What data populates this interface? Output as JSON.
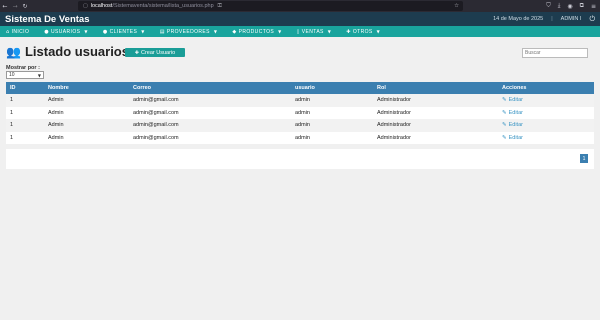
{
  "browser": {
    "host": "localhost",
    "path": "/Sistemaventa/sistema/lista_usuarios.php"
  },
  "header": {
    "app_title": "Sistema De Ventas",
    "date": "14 de Mayo de 2025",
    "separator": "|",
    "user": "ADMIN ",
    "user_badge": "I"
  },
  "nav": {
    "items": [
      {
        "label": "INICIO",
        "icon": "home-icon"
      },
      {
        "label": "USUARIOS",
        "icon": "user-icon"
      },
      {
        "label": "CLIENTES",
        "icon": "users-icon"
      },
      {
        "label": "PROVEEDORES",
        "icon": "building-icon"
      },
      {
        "label": "PRODUCTOS",
        "icon": "cubes-icon"
      },
      {
        "label": "VENTAS",
        "icon": "file-icon"
      },
      {
        "label": "OTROS",
        "icon": "plus-icon"
      }
    ]
  },
  "page": {
    "title": "Listado usuarios",
    "create_label": "Crear Usuario",
    "search_placeholder": "Buscar",
    "show_label": "Mostrar por :",
    "show_value": "10"
  },
  "table": {
    "headers": [
      "ID",
      "Nombre",
      "Correo",
      "usuario",
      "Rol",
      "Acciones"
    ],
    "rows": [
      {
        "id": "1",
        "name": "Admin",
        "email": "admin@gmail.com",
        "user": "admin",
        "role": "Administrador",
        "action": "Editar"
      },
      {
        "id": "1",
        "name": "Admin",
        "email": "admin@gmail.com",
        "user": "admin",
        "role": "Administrador",
        "action": "Editar"
      },
      {
        "id": "1",
        "name": "Admin",
        "email": "admin@gmail.com",
        "user": "admin",
        "role": "Administrador",
        "action": "Editar"
      },
      {
        "id": "1",
        "name": "Admin",
        "email": "admin@gmail.com",
        "user": "admin",
        "role": "Administrador",
        "action": "Editar"
      }
    ]
  },
  "pagination": {
    "current_page": "1"
  },
  "colors": {
    "header_bg": "#1d3c4f",
    "nav_bg": "#19a49d",
    "table_header_bg": "#3b7fb0",
    "edit_link": "#3a95c4"
  }
}
